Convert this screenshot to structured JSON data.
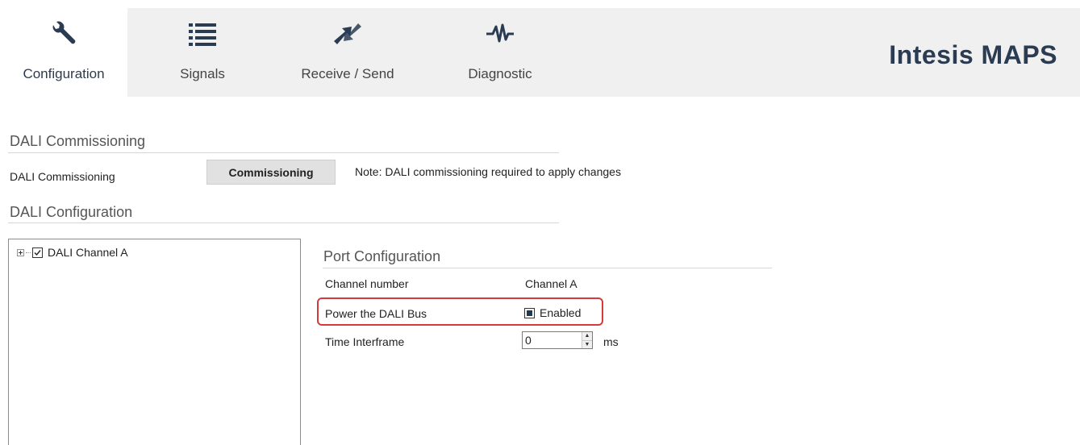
{
  "toolbar": {
    "tabs": [
      {
        "id": "configuration",
        "label": "Configuration",
        "icon": "wrench-icon",
        "active": true
      },
      {
        "id": "signals",
        "label": "Signals",
        "icon": "list-icon",
        "active": false
      },
      {
        "id": "receive_send",
        "label": "Receive / Send",
        "icon": "transfer-arrows-icon",
        "active": false
      },
      {
        "id": "diagnostic",
        "label": "Diagnostic",
        "icon": "pulse-icon",
        "active": false
      }
    ],
    "brand": "Intesis MAPS"
  },
  "commissioning": {
    "section_title": "DALI Commissioning",
    "row_label": "DALI Commissioning",
    "button_label": "Commissioning",
    "note": "Note: DALI commissioning required to apply changes"
  },
  "configuration": {
    "section_title": "DALI Configuration",
    "tree": {
      "items": [
        {
          "label": "DALI Channel A",
          "checked": true,
          "expanded": false
        }
      ]
    }
  },
  "port": {
    "title": "Port Configuration",
    "channel_label": "Channel number",
    "channel_value": "Channel A",
    "power_label": "Power the DALI Bus",
    "power_value": "Enabled",
    "power_checked": true,
    "interframe_label": "Time Interframe",
    "interframe_value": "0",
    "interframe_unit": "ms"
  },
  "colors": {
    "accent": "#2b3c52",
    "highlight": "#d63a3a",
    "toolbar_bg": "#f0f0f0"
  }
}
